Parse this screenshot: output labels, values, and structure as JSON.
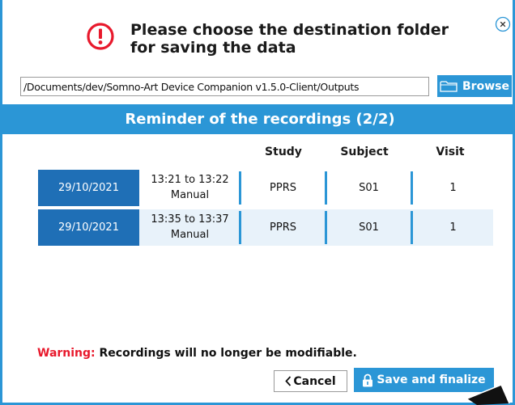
{
  "header": {
    "line1": "Please choose the destination folder",
    "line2": "for saving the data",
    "alert_icon": "exclamation-circle-icon",
    "close_icon": "close-circle-icon"
  },
  "path": {
    "value": "/Documents/dev/Somno-Art Device Companion v1.5.0-Client/Outputs"
  },
  "browse": {
    "label": "Browse",
    "icon": "folder-icon"
  },
  "banner": {
    "title": "Reminder of the recordings (2/2)"
  },
  "table": {
    "columns": {
      "study": "Study",
      "subject": "Subject",
      "visit": "Visit"
    },
    "rows": [
      {
        "date": "29/10/2021",
        "time": "13:21 to 13:22",
        "mode": "Manual",
        "study": "PPRS",
        "subject": "S01",
        "visit": "1"
      },
      {
        "date": "29/10/2021",
        "time": "13:35 to 13:37",
        "mode": "Manual",
        "study": "PPRS",
        "subject": "S01",
        "visit": "1"
      }
    ]
  },
  "warning": {
    "label": "Warning:",
    "text": "Recordings will no longer be modifiable."
  },
  "buttons": {
    "cancel": "Cancel",
    "save": "Save and finalize"
  },
  "colors": {
    "accent": "#2b96d6",
    "date_cell": "#1f6fb6",
    "alert": "#e8192c",
    "row_alt": "#e8f2fa"
  }
}
